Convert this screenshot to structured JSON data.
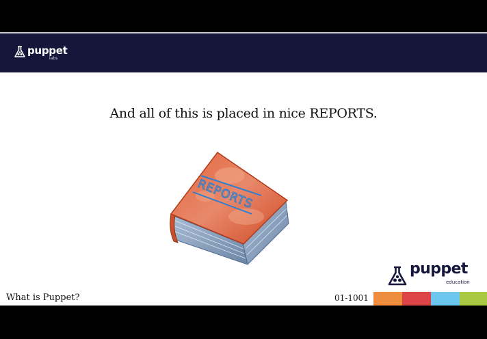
{
  "header": {
    "logo_word": "puppet",
    "logo_sub": "labs",
    "logo_icon": "puppet-flask-icon"
  },
  "slide": {
    "title": "And all of this is placed in nice REPORTS.",
    "illustration": {
      "subject": "book-icon",
      "cover_text": "REPORTS",
      "cover_color": "#d9542e",
      "pages_color": "#7f97b5",
      "stripe_color": "#2d7fcf"
    }
  },
  "footer": {
    "title": "What is Puppet?",
    "code": "01-1001",
    "logo_word": "puppet",
    "logo_sub": "education",
    "stripe_colors": [
      "#ee8d3e",
      "#dc4445",
      "#6cc6ee",
      "#a9c943"
    ]
  },
  "colors": {
    "header_bg": "#16163a",
    "slide_bg": "#ffffff",
    "letterbox": "#000000"
  }
}
